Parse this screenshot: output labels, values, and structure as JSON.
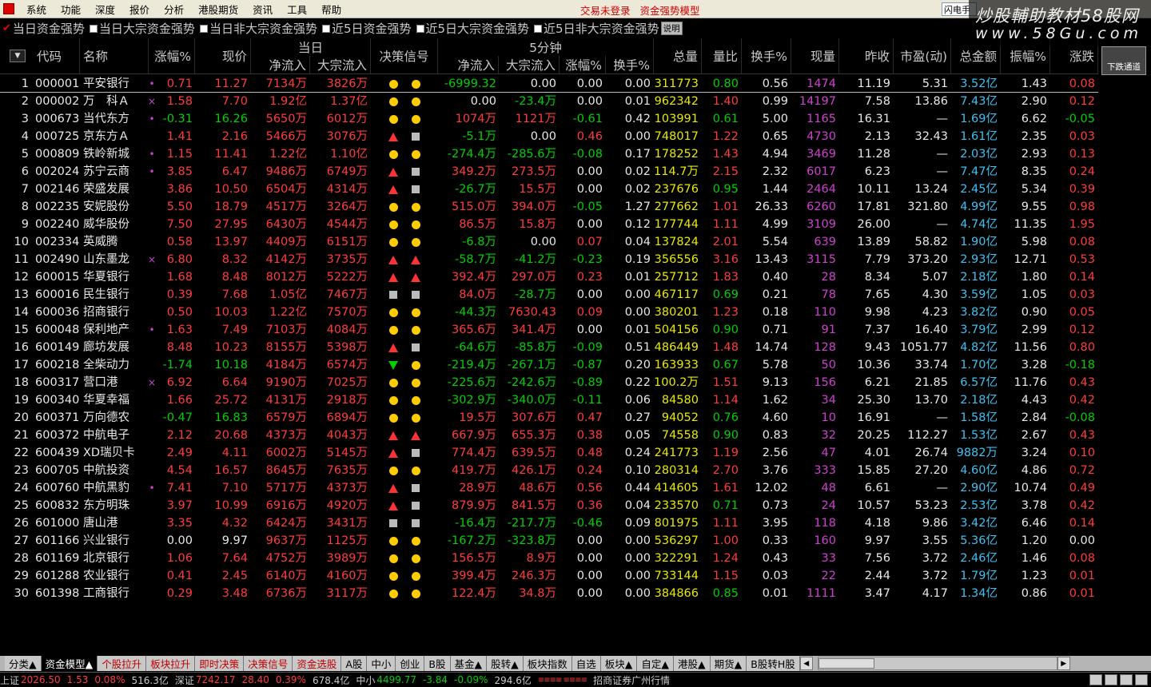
{
  "menu": {
    "items": [
      "系统",
      "功能",
      "深度",
      "报价",
      "分析",
      "港股期货",
      "资讯",
      "工具",
      "帮助"
    ],
    "center": [
      "交易未登录",
      "资金强势模型"
    ],
    "search": "闪电手"
  },
  "watermark": {
    "line1": "炒股輔助教材58股网",
    "line2": "www.58Gu.com"
  },
  "filters": [
    "当日资金强势",
    "当日大宗资金强势",
    "当日非大宗资金强势",
    "近5日资金强势",
    "近5日大宗资金强势",
    "近5日非大宗资金强势"
  ],
  "help_label": "说明",
  "headers": {
    "code": "代码",
    "name": "名称",
    "pct": "涨幅%",
    "price": "现价",
    "group_day": "当日",
    "net": "净流入",
    "block": "大宗流入",
    "signal": "决策信号",
    "group_5m": "5分钟",
    "net5": "净流入",
    "block5": "大宗流入",
    "pct5": "涨幅%",
    "turn5": "换手%",
    "vol": "总量",
    "vratio": "量比",
    "turn": "换手%",
    "cur": "现量",
    "prev": "昨收",
    "pe": "市盈(动)",
    "amt": "总金额",
    "amp": "振幅%",
    "chg": "涨跌"
  },
  "scroll_label": "下跌通道",
  "colors": {
    "red": "#ff3c3c",
    "green": "#00d000",
    "white": "#e8e8e8",
    "yellow": "#e8e800",
    "cyan": "#40c0f0",
    "magenta": "#d040d0",
    "label": "#c8c8c8"
  },
  "rows": [
    {
      "n": "1",
      "code": "000001",
      "name": "平安银行",
      "m": "•",
      "pct": "0.71",
      "price": "11.27",
      "net": "7134万",
      "block": "3826万",
      "s1": "dot",
      "s2": "dot",
      "net5": "-6999.32",
      "block5": "0.00",
      "pct5": "0.00",
      "turn5": "0.00",
      "vol": "311773",
      "vr": "0.80",
      "turn": "0.56",
      "cur": "1474",
      "prev": "11.19",
      "pe": "5.31",
      "amt": "3.52亿",
      "amp": "1.43",
      "chg": "0.08"
    },
    {
      "n": "2",
      "code": "000002",
      "name": "万　科Ａ",
      "m": "×",
      "pct": "1.58",
      "price": "7.70",
      "net": "1.92亿",
      "block": "1.37亿",
      "s1": "dot",
      "s2": "dot",
      "net5": "0.00",
      "block5": "-23.4万",
      "pct5": "0.00",
      "turn5": "0.01",
      "vol": "962342",
      "vr": "1.40",
      "turn": "0.99",
      "cur": "14197",
      "prev": "7.58",
      "pe": "13.86",
      "amt": "7.43亿",
      "amp": "2.90",
      "chg": "0.12"
    },
    {
      "n": "3",
      "code": "000673",
      "name": "当代东方",
      "m": "•",
      "pct": "-0.31",
      "price": "16.26",
      "net": "5650万",
      "block": "6012万",
      "s1": "dot",
      "s2": "dot",
      "net5": "1074万",
      "block5": "1121万",
      "pct5": "-0.61",
      "turn5": "0.42",
      "vol": "103991",
      "vr": "0.61",
      "turn": "5.00",
      "cur": "1165",
      "prev": "16.31",
      "pe": "—",
      "amt": "1.69亿",
      "amp": "6.62",
      "chg": "-0.05"
    },
    {
      "n": "4",
      "code": "000725",
      "name": "京东方Ａ",
      "m": "",
      "pct": "1.41",
      "price": "2.16",
      "net": "5466万",
      "block": "3076万",
      "s1": "up",
      "s2": "sq",
      "net5": "-5.1万",
      "block5": "0.00",
      "pct5": "0.46",
      "turn5": "0.00",
      "vol": "748017",
      "vr": "1.22",
      "turn": "0.65",
      "cur": "4730",
      "prev": "2.13",
      "pe": "32.43",
      "amt": "1.61亿",
      "amp": "2.35",
      "chg": "0.03"
    },
    {
      "n": "5",
      "code": "000809",
      "name": "铁岭新城",
      "m": "•",
      "pct": "1.15",
      "price": "11.41",
      "net": "1.22亿",
      "block": "1.10亿",
      "s1": "dot",
      "s2": "dot",
      "net5": "-274.4万",
      "block5": "-285.6万",
      "pct5": "-0.08",
      "turn5": "0.17",
      "vol": "178252",
      "vr": "1.43",
      "turn": "4.94",
      "cur": "3469",
      "prev": "11.28",
      "pe": "—",
      "amt": "2.03亿",
      "amp": "2.93",
      "chg": "0.13"
    },
    {
      "n": "6",
      "code": "002024",
      "name": "苏宁云商",
      "m": "•",
      "pct": "3.85",
      "price": "6.47",
      "net": "9486万",
      "block": "6749万",
      "s1": "up",
      "s2": "sq",
      "net5": "349.2万",
      "block5": "273.5万",
      "pct5": "0.00",
      "turn5": "0.02",
      "vol": "114.7万",
      "vr": "2.15",
      "turn": "2.32",
      "cur": "6017",
      "prev": "6.23",
      "pe": "—",
      "amt": "7.47亿",
      "amp": "8.35",
      "chg": "0.24"
    },
    {
      "n": "7",
      "code": "002146",
      "name": "荣盛发展",
      "m": "",
      "pct": "3.86",
      "price": "10.50",
      "net": "6504万",
      "block": "4314万",
      "s1": "up",
      "s2": "sq",
      "net5": "-26.7万",
      "block5": "15.5万",
      "pct5": "0.00",
      "turn5": "0.02",
      "vol": "237676",
      "vr": "0.95",
      "turn": "1.44",
      "cur": "2464",
      "prev": "10.11",
      "pe": "13.24",
      "amt": "2.45亿",
      "amp": "5.34",
      "chg": "0.39"
    },
    {
      "n": "8",
      "code": "002235",
      "name": "安妮股份",
      "m": "",
      "pct": "5.50",
      "price": "18.79",
      "net": "4517万",
      "block": "3264万",
      "s1": "dot",
      "s2": "dot",
      "net5": "515.0万",
      "block5": "394.0万",
      "pct5": "-0.05",
      "turn5": "1.27",
      "vol": "277662",
      "vr": "1.01",
      "turn": "26.33",
      "cur": "6260",
      "prev": "17.81",
      "pe": "321.80",
      "amt": "4.99亿",
      "amp": "9.55",
      "chg": "0.98"
    },
    {
      "n": "9",
      "code": "002240",
      "name": "威华股份",
      "m": "",
      "pct": "7.50",
      "price": "27.95",
      "net": "6430万",
      "block": "4544万",
      "s1": "dot",
      "s2": "dot",
      "net5": "86.5万",
      "block5": "15.8万",
      "pct5": "0.00",
      "turn5": "0.12",
      "vol": "177744",
      "vr": "1.11",
      "turn": "4.99",
      "cur": "3109",
      "prev": "26.00",
      "pe": "—",
      "amt": "4.74亿",
      "amp": "11.35",
      "chg": "1.95"
    },
    {
      "n": "10",
      "code": "002334",
      "name": "英威腾",
      "m": "",
      "pct": "0.58",
      "price": "13.97",
      "net": "4409万",
      "block": "6151万",
      "s1": "dot",
      "s2": "dot",
      "net5": "-6.8万",
      "block5": "0.00",
      "pct5": "0.07",
      "turn5": "0.04",
      "vol": "137824",
      "vr": "2.01",
      "turn": "5.54",
      "cur": "639",
      "prev": "13.89",
      "pe": "58.82",
      "amt": "1.90亿",
      "amp": "5.98",
      "chg": "0.08"
    },
    {
      "n": "11",
      "code": "002490",
      "name": "山东墨龙",
      "m": "×",
      "pct": "6.80",
      "price": "8.32",
      "net": "4142万",
      "block": "3735万",
      "s1": "up",
      "s2": "up",
      "net5": "-58.7万",
      "block5": "-41.2万",
      "pct5": "-0.23",
      "turn5": "0.19",
      "vol": "356556",
      "vr": "3.16",
      "turn": "13.43",
      "cur": "3115",
      "prev": "7.79",
      "pe": "373.20",
      "amt": "2.93亿",
      "amp": "12.71",
      "chg": "0.53"
    },
    {
      "n": "12",
      "code": "600015",
      "name": "华夏银行",
      "m": "",
      "pct": "1.68",
      "price": "8.48",
      "net": "8012万",
      "block": "5222万",
      "s1": "up",
      "s2": "up",
      "net5": "392.4万",
      "block5": "297.0万",
      "pct5": "0.23",
      "turn5": "0.01",
      "vol": "257712",
      "vr": "1.83",
      "turn": "0.40",
      "cur": "28",
      "prev": "8.34",
      "pe": "5.07",
      "amt": "2.18亿",
      "amp": "1.80",
      "chg": "0.14"
    },
    {
      "n": "13",
      "code": "600016",
      "name": "民生银行",
      "m": "",
      "pct": "0.39",
      "price": "7.68",
      "net": "1.05亿",
      "block": "7467万",
      "s1": "sq",
      "s2": "sq",
      "net5": "84.0万",
      "block5": "-28.7万",
      "pct5": "0.00",
      "turn5": "0.00",
      "vol": "467117",
      "vr": "0.69",
      "turn": "0.21",
      "cur": "78",
      "prev": "7.65",
      "pe": "4.30",
      "amt": "3.59亿",
      "amp": "1.05",
      "chg": "0.03"
    },
    {
      "n": "14",
      "code": "600036",
      "name": "招商银行",
      "m": "",
      "pct": "0.50",
      "price": "10.03",
      "net": "1.22亿",
      "block": "7570万",
      "s1": "dot",
      "s2": "dot",
      "net5": "-44.3万",
      "block5": "7630.43",
      "pct5": "0.09",
      "turn5": "0.00",
      "vol": "380201",
      "vr": "1.23",
      "turn": "0.18",
      "cur": "110",
      "prev": "9.98",
      "pe": "4.23",
      "amt": "3.82亿",
      "amp": "0.90",
      "chg": "0.05"
    },
    {
      "n": "15",
      "code": "600048",
      "name": "保利地产",
      "m": "•",
      "pct": "1.63",
      "price": "7.49",
      "net": "7103万",
      "block": "4084万",
      "s1": "dot",
      "s2": "dot",
      "net5": "365.6万",
      "block5": "341.4万",
      "pct5": "0.00",
      "turn5": "0.01",
      "vol": "504156",
      "vr": "0.90",
      "turn": "0.71",
      "cur": "91",
      "prev": "7.37",
      "pe": "16.40",
      "amt": "3.79亿",
      "amp": "2.99",
      "chg": "0.12"
    },
    {
      "n": "16",
      "code": "600149",
      "name": "廊坊发展",
      "m": "",
      "pct": "8.48",
      "price": "10.23",
      "net": "8155万",
      "block": "5398万",
      "s1": "up",
      "s2": "sq",
      "net5": "-64.6万",
      "block5": "-85.8万",
      "pct5": "-0.09",
      "turn5": "0.51",
      "vol": "486449",
      "vr": "1.48",
      "turn": "14.74",
      "cur": "128",
      "prev": "9.43",
      "pe": "1051.77",
      "amt": "4.82亿",
      "amp": "11.56",
      "chg": "0.80"
    },
    {
      "n": "17",
      "code": "600218",
      "name": "全柴动力",
      "m": "",
      "pct": "-1.74",
      "price": "10.18",
      "net": "4184万",
      "block": "6574万",
      "s1": "dn",
      "s2": "dot",
      "net5": "-219.4万",
      "block5": "-267.1万",
      "pct5": "-0.87",
      "turn5": "0.20",
      "vol": "163933",
      "vr": "0.67",
      "turn": "5.78",
      "cur": "50",
      "prev": "10.36",
      "pe": "33.74",
      "amt": "1.70亿",
      "amp": "3.28",
      "chg": "-0.18"
    },
    {
      "n": "18",
      "code": "600317",
      "name": "营口港",
      "m": "×",
      "pct": "6.92",
      "price": "6.64",
      "net": "9190万",
      "block": "7025万",
      "s1": "dot",
      "s2": "dot",
      "net5": "-225.6万",
      "block5": "-242.6万",
      "pct5": "-0.89",
      "turn5": "0.22",
      "vol": "100.2万",
      "vr": "1.51",
      "turn": "9.13",
      "cur": "156",
      "prev": "6.21",
      "pe": "21.85",
      "amt": "6.57亿",
      "amp": "11.76",
      "chg": "0.43"
    },
    {
      "n": "19",
      "code": "600340",
      "name": "华夏幸福",
      "m": "",
      "pct": "1.66",
      "price": "25.72",
      "net": "4131万",
      "block": "2918万",
      "s1": "dot",
      "s2": "dot",
      "net5": "-302.9万",
      "block5": "-340.0万",
      "pct5": "-0.11",
      "turn5": "0.06",
      "vol": "84580",
      "vr": "1.14",
      "turn": "1.62",
      "cur": "34",
      "prev": "25.30",
      "pe": "13.70",
      "amt": "2.18亿",
      "amp": "4.43",
      "chg": "0.42"
    },
    {
      "n": "20",
      "code": "600371",
      "name": "万向德农",
      "m": "",
      "pct": "-0.47",
      "price": "16.83",
      "net": "6579万",
      "block": "6894万",
      "s1": "dot",
      "s2": "dot",
      "net5": "19.5万",
      "block5": "307.6万",
      "pct5": "0.47",
      "turn5": "0.27",
      "vol": "94052",
      "vr": "0.76",
      "turn": "4.60",
      "cur": "10",
      "prev": "16.91",
      "pe": "—",
      "amt": "1.58亿",
      "amp": "2.84",
      "chg": "-0.08"
    },
    {
      "n": "21",
      "code": "600372",
      "name": "中航电子",
      "m": "",
      "pct": "2.12",
      "price": "20.68",
      "net": "4373万",
      "block": "4043万",
      "s1": "up",
      "s2": "up",
      "net5": "667.9万",
      "block5": "655.3万",
      "pct5": "0.38",
      "turn5": "0.05",
      "vol": "74558",
      "vr": "0.90",
      "turn": "0.83",
      "cur": "32",
      "prev": "20.25",
      "pe": "112.27",
      "amt": "1.53亿",
      "amp": "2.67",
      "chg": "0.43"
    },
    {
      "n": "22",
      "code": "600439",
      "name": "XD瑞贝卡",
      "m": "",
      "pct": "2.49",
      "price": "4.11",
      "net": "6002万",
      "block": "5145万",
      "s1": "up",
      "s2": "sq",
      "net5": "774.4万",
      "block5": "639.5万",
      "pct5": "0.48",
      "turn5": "0.24",
      "vol": "241773",
      "vr": "1.19",
      "turn": "2.56",
      "cur": "47",
      "prev": "4.01",
      "pe": "26.74",
      "amt": "9882万",
      "amp": "3.24",
      "chg": "0.10"
    },
    {
      "n": "23",
      "code": "600705",
      "name": "中航投资",
      "m": "",
      "pct": "4.54",
      "price": "16.57",
      "net": "8645万",
      "block": "7635万",
      "s1": "dot",
      "s2": "dot",
      "net5": "419.7万",
      "block5": "426.1万",
      "pct5": "0.24",
      "turn5": "0.10",
      "vol": "280314",
      "vr": "2.70",
      "turn": "3.76",
      "cur": "333",
      "prev": "15.85",
      "pe": "27.20",
      "amt": "4.60亿",
      "amp": "4.86",
      "chg": "0.72"
    },
    {
      "n": "24",
      "code": "600760",
      "name": "中航黑豹",
      "m": "•",
      "pct": "7.41",
      "price": "7.10",
      "net": "5717万",
      "block": "4373万",
      "s1": "up",
      "s2": "sq",
      "net5": "28.9万",
      "block5": "48.6万",
      "pct5": "0.56",
      "turn5": "0.44",
      "vol": "414605",
      "vr": "1.61",
      "turn": "12.02",
      "cur": "48",
      "prev": "6.61",
      "pe": "—",
      "amt": "2.90亿",
      "amp": "10.74",
      "chg": "0.49"
    },
    {
      "n": "25",
      "code": "600832",
      "name": "东方明珠",
      "m": "",
      "pct": "3.97",
      "price": "10.99",
      "net": "6916万",
      "block": "4920万",
      "s1": "up",
      "s2": "sq",
      "net5": "879.9万",
      "block5": "841.5万",
      "pct5": "0.36",
      "turn5": "0.04",
      "vol": "233570",
      "vr": "0.71",
      "turn": "0.73",
      "cur": "24",
      "prev": "10.57",
      "pe": "53.23",
      "amt": "2.53亿",
      "amp": "3.78",
      "chg": "0.42"
    },
    {
      "n": "26",
      "code": "601000",
      "name": "唐山港",
      "m": "",
      "pct": "3.35",
      "price": "4.32",
      "net": "6424万",
      "block": "3431万",
      "s1": "sq",
      "s2": "sq",
      "net5": "-16.4万",
      "block5": "-217.7万",
      "pct5": "-0.46",
      "turn5": "0.09",
      "vol": "801975",
      "vr": "1.11",
      "turn": "3.95",
      "cur": "118",
      "prev": "4.18",
      "pe": "9.86",
      "amt": "3.42亿",
      "amp": "6.46",
      "chg": "0.14"
    },
    {
      "n": "27",
      "code": "601166",
      "name": "兴业银行",
      "m": "",
      "pct": "0.00",
      "price": "9.97",
      "net": "9637万",
      "block": "1125万",
      "s1": "dot",
      "s2": "dot",
      "net5": "-167.2万",
      "block5": "-323.8万",
      "pct5": "0.00",
      "turn5": "0.00",
      "vol": "536297",
      "vr": "1.00",
      "turn": "0.33",
      "cur": "160",
      "prev": "9.97",
      "pe": "3.55",
      "amt": "5.36亿",
      "amp": "1.20",
      "chg": "0.00"
    },
    {
      "n": "28",
      "code": "601169",
      "name": "北京银行",
      "m": "",
      "pct": "1.06",
      "price": "7.64",
      "net": "4752万",
      "block": "3989万",
      "s1": "dot",
      "s2": "dot",
      "net5": "156.5万",
      "block5": "8.9万",
      "pct5": "0.00",
      "turn5": "0.00",
      "vol": "322291",
      "vr": "1.24",
      "turn": "0.43",
      "cur": "33",
      "prev": "7.56",
      "pe": "3.72",
      "amt": "2.46亿",
      "amp": "1.46",
      "chg": "0.08"
    },
    {
      "n": "29",
      "code": "601288",
      "name": "农业银行",
      "m": "",
      "pct": "0.41",
      "price": "2.45",
      "net": "6140万",
      "block": "4160万",
      "s1": "dot",
      "s2": "dot",
      "net5": "399.4万",
      "block5": "246.3万",
      "pct5": "0.00",
      "turn5": "0.00",
      "vol": "733144",
      "vr": "1.15",
      "turn": "0.03",
      "cur": "22",
      "prev": "2.44",
      "pe": "3.72",
      "amt": "1.79亿",
      "amp": "1.23",
      "chg": "0.01"
    },
    {
      "n": "30",
      "code": "601398",
      "name": "工商银行",
      "m": "",
      "pct": "0.29",
      "price": "3.48",
      "net": "6736万",
      "block": "3117万",
      "s1": "dot",
      "s2": "dot",
      "net5": "122.4万",
      "block5": "34.8万",
      "pct5": "0.00",
      "turn5": "0.00",
      "vol": "384866",
      "vr": "0.85",
      "turn": "0.01",
      "cur": "1111",
      "prev": "3.47",
      "pe": "4.17",
      "amt": "1.34亿",
      "amp": "0.86",
      "chg": "0.01"
    }
  ],
  "tabs": [
    {
      "label": "分类▲",
      "style": "normal"
    },
    {
      "label": "资金模型▲",
      "style": "active"
    },
    {
      "label": "个股拉升",
      "style": "red"
    },
    {
      "label": "板块拉升",
      "style": "red"
    },
    {
      "label": "即时决策",
      "style": "red"
    },
    {
      "label": "决策信号",
      "style": "red"
    },
    {
      "label": "资金选股",
      "style": "red"
    },
    {
      "label": "A股",
      "style": "normal"
    },
    {
      "label": "中小",
      "style": "normal"
    },
    {
      "label": "创业",
      "style": "normal"
    },
    {
      "label": "B股",
      "style": "normal"
    },
    {
      "label": "基金▲",
      "style": "normal"
    },
    {
      "label": "股转▲",
      "style": "normal"
    },
    {
      "label": "板块指数",
      "style": "normal"
    },
    {
      "label": "自选",
      "style": "normal"
    },
    {
      "label": "板块▲",
      "style": "normal"
    },
    {
      "label": "自定▲",
      "style": "normal"
    },
    {
      "label": "港股▲",
      "style": "normal"
    },
    {
      "label": "期货▲",
      "style": "normal"
    },
    {
      "label": "B股转H股",
      "style": "normal"
    }
  ],
  "status": {
    "sh_label": "上证",
    "sh_val": "2026.50",
    "sh_chg": "1.53",
    "sh_pct": "0.08%",
    "sh_amt": "516.3亿",
    "sz_label": "深证",
    "sz_val": "7242.17",
    "sz_chg": "28.40",
    "sz_pct": "0.39%",
    "sz_amt": "678.4亿",
    "zx_label": "中小",
    "zx_val": "4499.77",
    "zx_chg": "-3.84",
    "zx_pct": "-0.09%",
    "zx_amt": "294.6亿",
    "broker": "招商证券广州行情"
  }
}
